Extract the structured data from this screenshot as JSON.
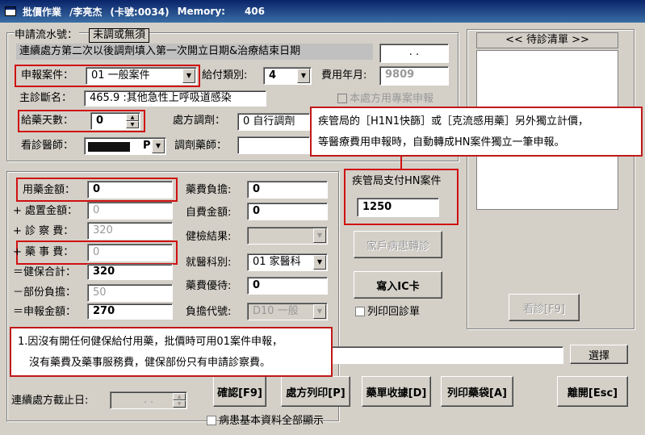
{
  "title": {
    "app": "批價作業",
    "user": "/李亮杰",
    "card": "(卡號:0034)",
    "memory_label": "Memory:",
    "memory_value": "406"
  },
  "form": {
    "serial_label": "申請流水號：",
    "serial_value": "未調或無須",
    "continuous_note": "連續處方第二次以後調劑填入第一次開立日期&治療結束日期",
    "continuous_date": ". .",
    "case_label": "申報案件：",
    "case_value": "01 一般案件",
    "pay_type_label": "給付類別:",
    "pay_type_value": "4",
    "fee_month_label": "費用年月:",
    "fee_month_value": "9809",
    "diagnosis_label": "主診斷名：",
    "diagnosis_value": "465.9 :其他急性上呼吸道感染",
    "special_project_label": "本處方用專案申報",
    "days_label": "給藥天數：",
    "days_value": "0",
    "rx_dispense_label": "處方調劑：",
    "rx_dispense_value": "0 自行調劑",
    "doctor_label": "看診醫師：",
    "doctor_value": "P",
    "pharmacist_label": "調劑藥師："
  },
  "fees": {
    "drug_amount_label": "用藥金額：",
    "drug_amount_value": "0",
    "disposal_label": "+ 處置金額：",
    "disposal_value": "0",
    "consult_label": "+ 診 察 費：",
    "consult_value": "320",
    "pharmacy_label": "+ 藥 事 費：",
    "pharmacy_value": "0",
    "insurance_total_label": "＝健保合計：",
    "insurance_total_value": "320",
    "copay_label": "－部份負擔：",
    "copay_value": "50",
    "claim_label": "＝申報金額：",
    "claim_value": "270",
    "drug_burden_label": "藥費負擔:",
    "drug_burden_value": "0",
    "self_pay_label": "自費金額:",
    "self_pay_value": "0",
    "health_check_label": "健檢結果:",
    "dept_label": "就醫科別:",
    "dept_value": "01 家醫科",
    "discount_label": "藥費優待:",
    "discount_value": "0",
    "burden_code_label": "負擔代號:",
    "burden_code_value": "D10 一般"
  },
  "right": {
    "pending_title": "<< 待診清單 >>"
  },
  "hn": {
    "label": "疾管局支付HN案件",
    "value": "1250"
  },
  "buttons": {
    "family_transfer": "家戶病患轉診",
    "write_ic": "寫入IC卡",
    "print_return": "列印回診單",
    "consult": "看診[F9]",
    "select": "選擇",
    "confirm": "確認[F9]",
    "rx_print": "處方列印[P]",
    "drug_receipt": "藥單收據[D]",
    "print_bag": "列印藥袋[A]",
    "exit": "離開[Esc]"
  },
  "bottom": {
    "continuous_end_label": "連續處方截止日:",
    "continuous_end_value": ". .",
    "show_all_label": "病患基本資料全部顯示"
  },
  "callouts": {
    "top_line1": "疾管局的［H1N1快篩］或［克流感用藥］另外獨立計價，",
    "top_line2": "等醫療費用申報時，自動轉成HN案件獨立一筆申報。",
    "bottom_line1": "1.因沒有開任何健保給付用藥，批價時可用01案件申報，",
    "bottom_line2": "沒有藥費及藥事服務費，健保部份只有申請診察費。"
  },
  "colors": {
    "annotation_red": "#d01010",
    "window_bg": "#d4d0c8",
    "title_blue": "#0a246a"
  }
}
